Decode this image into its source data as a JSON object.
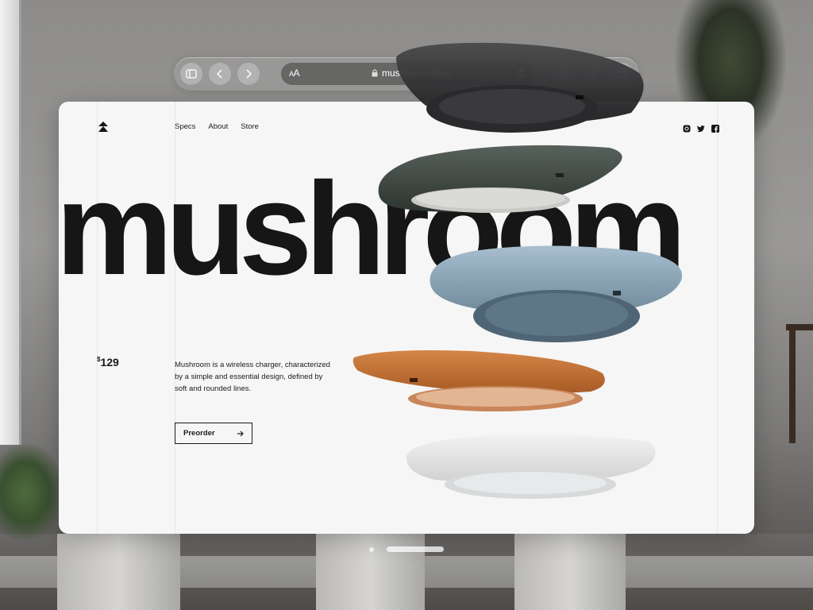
{
  "browser": {
    "text_size_label_small": "A",
    "text_size_label_large": "A",
    "url": "mushroom.store",
    "icons": [
      "sidebar-icon",
      "back-icon",
      "forward-icon",
      "lock-icon",
      "reload-icon",
      "share-icon",
      "new-tab-icon",
      "tabs-icon"
    ]
  },
  "site": {
    "nav": [
      "Specs",
      "About",
      "Store"
    ],
    "social_icons": [
      "instagram-icon",
      "twitter-icon",
      "facebook-icon"
    ],
    "headline": "mushroom",
    "price_currency": "$",
    "price_value": "129",
    "description": "Mushroom is a wireless charger, characterized by a simple and essential design, defined by soft and rounded lines.",
    "cta_label": "Preorder",
    "colors": {
      "background": "#f6f6f6",
      "text": "#161616",
      "charger_colors": [
        "#2d2d2f",
        "#3a423e",
        "#8fa7ba",
        "#c8733c",
        "#d9dadb"
      ]
    }
  }
}
